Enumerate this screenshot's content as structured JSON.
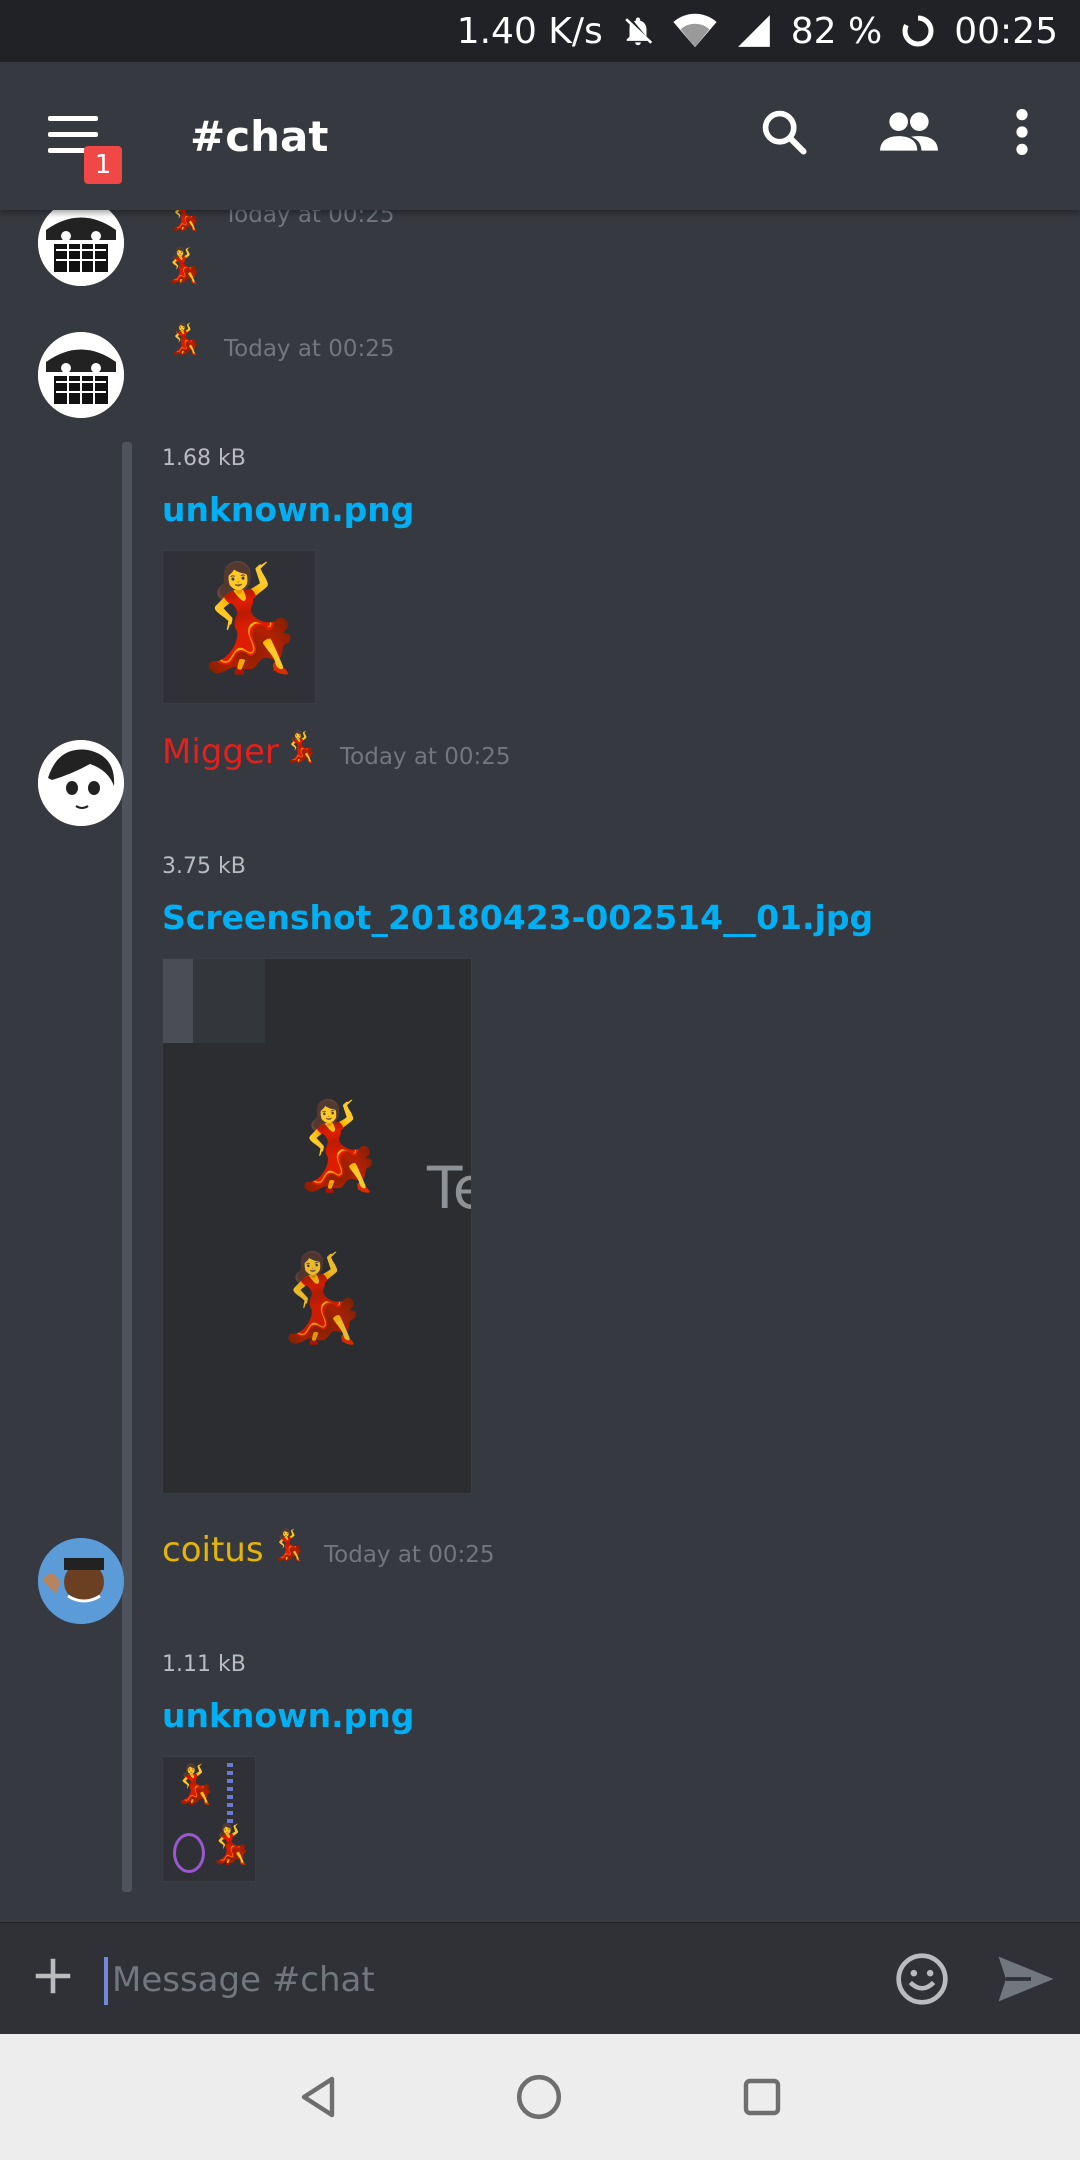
{
  "status_bar": {
    "speed": "1.40 K/s",
    "battery": "82 %",
    "time": "00:25"
  },
  "header": {
    "menu_badge": "1",
    "channel": "#chat"
  },
  "messages": [
    {
      "username": "",
      "timestamp": "Today at 00:25",
      "body_emoji": "💃"
    },
    {
      "username": "",
      "timestamp": "Today at 00:25",
      "attachment": {
        "size": "1.68 kB",
        "filename": "unknown.png"
      }
    },
    {
      "username": "Migger",
      "username_color": "#e0211d",
      "timestamp": "Today at 00:25",
      "attachment": {
        "size": "3.75 kB",
        "filename": "Screenshot_20180423-002514__01.jpg"
      }
    },
    {
      "username": "coitus",
      "username_color": "#e3b505",
      "timestamp": "Today at 00:25",
      "attachment": {
        "size": "1.11 kB",
        "filename": "unknown.png"
      }
    }
  ],
  "input": {
    "placeholder": "Message #chat"
  },
  "colors": {
    "background": "#36393f",
    "link": "#00b0f4",
    "badge": "#f04747",
    "accent": "#7289da"
  },
  "icons": {
    "emoji": "💃",
    "mobile_screenshot_text": "Te"
  }
}
